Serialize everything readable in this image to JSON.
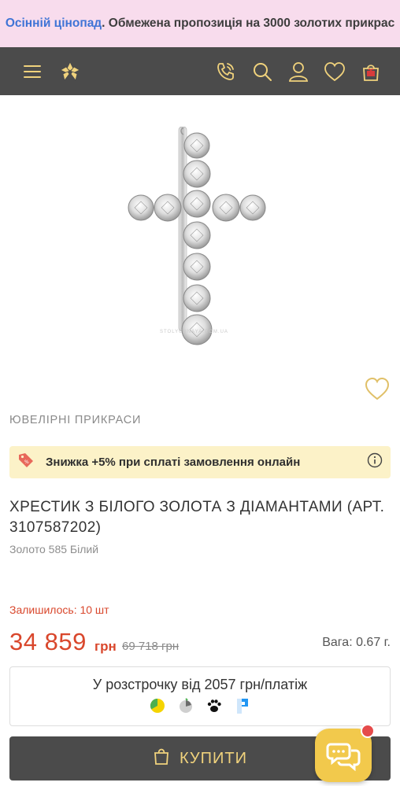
{
  "promo": {
    "highlight": "Осінній цінопад",
    "text": ". Обмежена пропозиція на 3000 золотих прикрас"
  },
  "header": {
    "icons": [
      "menu-icon",
      "logo-flower-icon",
      "phone-icon",
      "search-icon",
      "user-icon",
      "heart-icon",
      "cart-icon"
    ]
  },
  "product": {
    "watermark": "STOLYCHNAYA.COM.UA",
    "category": "ЮВЕЛІРНІ ПРИКРАСИ",
    "discount_text": "Знижка +5% при сплаті замовлення онлайн",
    "title": "ХРЕСТИК З БІЛОГО ЗОЛОТА З ДІАМАНТАМИ (АРТ. 3107587202)",
    "subtitle": "Золото 585 Білий",
    "stock": "Залишилось: 10 шт",
    "price": "34 859",
    "price_currency": "грн",
    "old_price": "69 718 грн",
    "weight": "Вага: 0.67 г."
  },
  "installment": {
    "label": "У розстрочку від 2057 грн/платіж",
    "banks": [
      "privat-pay-icon",
      "mono-icon",
      "paw-icon",
      "pumb-icon"
    ]
  },
  "buy": {
    "label": "КУПИТИ"
  },
  "colors": {
    "header_bg": "#4b4b4b",
    "accent_gold": "#f0d27c",
    "price_red": "#d9472c",
    "promo_bg": "#f8dced",
    "discount_bg": "#fcf2c8",
    "chat_yellow": "#f2c94c"
  }
}
